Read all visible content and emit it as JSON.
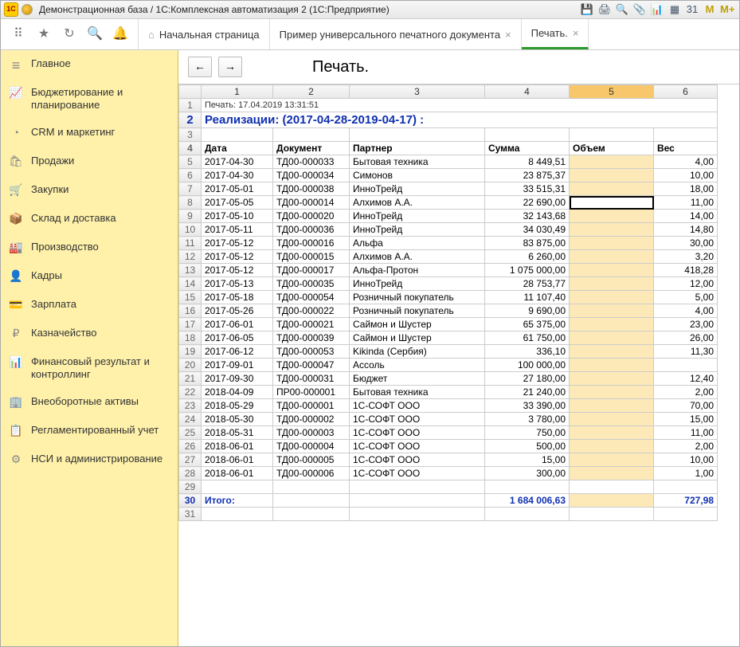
{
  "titlebar": {
    "app_logo_text": "1C",
    "title": "Демонстрационная база / 1С:Комплексная автоматизация 2  (1С:Предприятие)",
    "icons": {
      "save": "💾",
      "print": "🖨",
      "preview": "🔍",
      "attach": "📎",
      "report": "📊",
      "table": "▦",
      "calendar": "31",
      "m": "M",
      "mplus": "M+"
    }
  },
  "navicons": {
    "grid": "⠿",
    "star": "★",
    "history": "↻",
    "search": "🔍",
    "bell": "🔔"
  },
  "tabs": {
    "home_label": "Начальная страница",
    "doc_label": "Пример универсального печатного документа",
    "print_label": "Печать.",
    "close": "×"
  },
  "sidebar": {
    "items": [
      {
        "icon": "≡",
        "label": "Главное"
      },
      {
        "icon": "📈",
        "label": "Бюджетирование и планирование"
      },
      {
        "icon": "◔",
        "label": "CRM и маркетинг"
      },
      {
        "icon": "🛍",
        "label": "Продажи"
      },
      {
        "icon": "🛒",
        "label": "Закупки"
      },
      {
        "icon": "📦",
        "label": "Склад и доставка"
      },
      {
        "icon": "🏭",
        "label": "Производство"
      },
      {
        "icon": "👤",
        "label": "Кадры"
      },
      {
        "icon": "💳",
        "label": "Зарплата"
      },
      {
        "icon": "₽",
        "label": "Казначейство"
      },
      {
        "icon": "📊",
        "label": "Финансовый результат и контроллинг"
      },
      {
        "icon": "🏢",
        "label": "Внеоборотные активы"
      },
      {
        "icon": "📋",
        "label": "Регламентированный учет"
      },
      {
        "icon": "⚙",
        "label": "НСИ и администрирование"
      }
    ]
  },
  "content": {
    "back": "←",
    "fwd": "→",
    "page_title": "Печать.",
    "print_line": "Печать: 17.04.2019 13:31:51",
    "doc_title": "Реализации: (2017-04-28-2019-04-17) :",
    "col_headers": [
      "1",
      "2",
      "3",
      "4",
      "5",
      "6"
    ],
    "table_headers": {
      "date": "Дата",
      "doc": "Документ",
      "partner": "Партнер",
      "sum": "Сумма",
      "vol": "Объем",
      "weight": "Вес"
    },
    "selected_col": 5,
    "selected_row": 8,
    "rows": [
      {
        "n": 5,
        "date": "2017-04-30",
        "doc": "ТД00-000033",
        "partner": "Бытовая техника",
        "sum": "8 449,51",
        "vol": "",
        "weight": "4,00"
      },
      {
        "n": 6,
        "date": "2017-04-30",
        "doc": "ТД00-000034",
        "partner": "Симонов",
        "sum": "23 875,37",
        "vol": "",
        "weight": "10,00"
      },
      {
        "n": 7,
        "date": "2017-05-01",
        "doc": "ТД00-000038",
        "partner": "ИнноТрейд",
        "sum": "33 515,31",
        "vol": "",
        "weight": "18,00"
      },
      {
        "n": 8,
        "date": "2017-05-05",
        "doc": "ТД00-000014",
        "partner": "Алхимов А.А.",
        "sum": "22 690,00",
        "vol": "",
        "weight": "11,00"
      },
      {
        "n": 9,
        "date": "2017-05-10",
        "doc": "ТД00-000020",
        "partner": "ИнноТрейд",
        "sum": "32 143,68",
        "vol": "",
        "weight": "14,00"
      },
      {
        "n": 10,
        "date": "2017-05-11",
        "doc": "ТД00-000036",
        "partner": "ИнноТрейд",
        "sum": "34 030,49",
        "vol": "",
        "weight": "14,80"
      },
      {
        "n": 11,
        "date": "2017-05-12",
        "doc": "ТД00-000016",
        "partner": "Альфа",
        "sum": "83 875,00",
        "vol": "",
        "weight": "30,00"
      },
      {
        "n": 12,
        "date": "2017-05-12",
        "doc": "ТД00-000015",
        "partner": "Алхимов А.А.",
        "sum": "6 260,00",
        "vol": "",
        "weight": "3,20"
      },
      {
        "n": 13,
        "date": "2017-05-12",
        "doc": "ТД00-000017",
        "partner": "Альфа-Протон",
        "sum": "1 075 000,00",
        "vol": "",
        "weight": "418,28"
      },
      {
        "n": 14,
        "date": "2017-05-13",
        "doc": "ТД00-000035",
        "partner": "ИнноТрейд",
        "sum": "28 753,77",
        "vol": "",
        "weight": "12,00"
      },
      {
        "n": 15,
        "date": "2017-05-18",
        "doc": "ТД00-000054",
        "partner": "Розничный покупатель",
        "sum": "11 107,40",
        "vol": "",
        "weight": "5,00"
      },
      {
        "n": 16,
        "date": "2017-05-26",
        "doc": "ТД00-000022",
        "partner": "Розничный покупатель",
        "sum": "9 690,00",
        "vol": "",
        "weight": "4,00"
      },
      {
        "n": 17,
        "date": "2017-06-01",
        "doc": "ТД00-000021",
        "partner": "Саймон и Шустер",
        "sum": "65 375,00",
        "vol": "",
        "weight": "23,00"
      },
      {
        "n": 18,
        "date": "2017-06-05",
        "doc": "ТД00-000039",
        "partner": "Саймон и Шустер",
        "sum": "61 750,00",
        "vol": "",
        "weight": "26,00"
      },
      {
        "n": 19,
        "date": "2017-06-12",
        "doc": "ТД00-000053",
        "partner": "Kikinda (Сербия)",
        "sum": "336,10",
        "vol": "",
        "weight": "11,30"
      },
      {
        "n": 20,
        "date": "2017-09-01",
        "doc": "ТД00-000047",
        "partner": "Ассоль",
        "sum": "100 000,00",
        "vol": "",
        "weight": ""
      },
      {
        "n": 21,
        "date": "2017-09-30",
        "doc": "ТД00-000031",
        "partner": "Бюджет",
        "sum": "27 180,00",
        "vol": "",
        "weight": "12,40"
      },
      {
        "n": 22,
        "date": "2018-04-09",
        "doc": "ПР00-000001",
        "partner": "Бытовая техника",
        "sum": "21 240,00",
        "vol": "",
        "weight": "2,00"
      },
      {
        "n": 23,
        "date": "2018-05-29",
        "doc": "ТД00-000001",
        "partner": "1С-СОФТ ООО",
        "sum": "33 390,00",
        "vol": "",
        "weight": "70,00"
      },
      {
        "n": 24,
        "date": "2018-05-30",
        "doc": "ТД00-000002",
        "partner": "1С-СОФТ ООО",
        "sum": "3 780,00",
        "vol": "",
        "weight": "15,00"
      },
      {
        "n": 25,
        "date": "2018-05-31",
        "doc": "ТД00-000003",
        "partner": "1С-СОФТ ООО",
        "sum": "750,00",
        "vol": "",
        "weight": "11,00"
      },
      {
        "n": 26,
        "date": "2018-06-01",
        "doc": "ТД00-000004",
        "partner": "1С-СОФТ ООО",
        "sum": "500,00",
        "vol": "",
        "weight": "2,00"
      },
      {
        "n": 27,
        "date": "2018-06-01",
        "doc": "ТД00-000005",
        "partner": "1С-СОФТ ООО",
        "sum": "15,00",
        "vol": "",
        "weight": "10,00"
      },
      {
        "n": 28,
        "date": "2018-06-01",
        "doc": "ТД00-000006",
        "partner": "1С-СОФТ ООО",
        "sum": "300,00",
        "vol": "",
        "weight": "1,00"
      }
    ],
    "total_label": "Итого:",
    "total_sum": "1 684 006,63",
    "total_weight": "727,98"
  }
}
